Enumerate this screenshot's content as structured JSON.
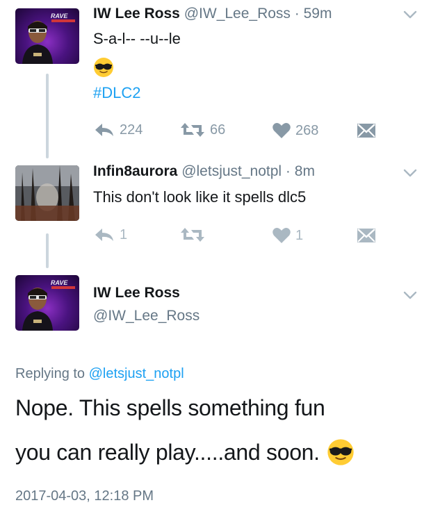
{
  "tweets": [
    {
      "display_name": "IW Lee Ross",
      "handle_time": "@IW_Lee_Ross · 59m",
      "text": "S-a-l-- --u--le",
      "hashtag": "#DLC2",
      "actions": {
        "reply": "224",
        "retweet": "66",
        "like": "268"
      }
    },
    {
      "display_name": "Infin8aurora",
      "handle_time": "@letsjust_notpl · 8m",
      "text": "This don't look like it spells dlc5",
      "actions": {
        "reply": "1",
        "retweet": "",
        "like": "1"
      }
    }
  ],
  "main_tweet": {
    "display_name": "IW Lee Ross",
    "handle": "@IW_Lee_Ross",
    "replying_prefix": "Replying to",
    "replying_to": "@letsjust_notpl",
    "text_line1": "Nope. This spells something fun",
    "text_line2": "you can really play.....and soon.",
    "timestamp": "2017-04-03, 12:18 PM"
  },
  "avatar_logo_text": "RAVE",
  "icons": [
    "reply-icon",
    "retweet-icon",
    "like-icon",
    "dm-icon",
    "chevron-down-icon",
    "sunglasses-emoji"
  ],
  "colors": {
    "link": "#1da1f2",
    "secondary": "#657786",
    "action": "#8899a6",
    "thread_line": "#ccd6dd"
  }
}
